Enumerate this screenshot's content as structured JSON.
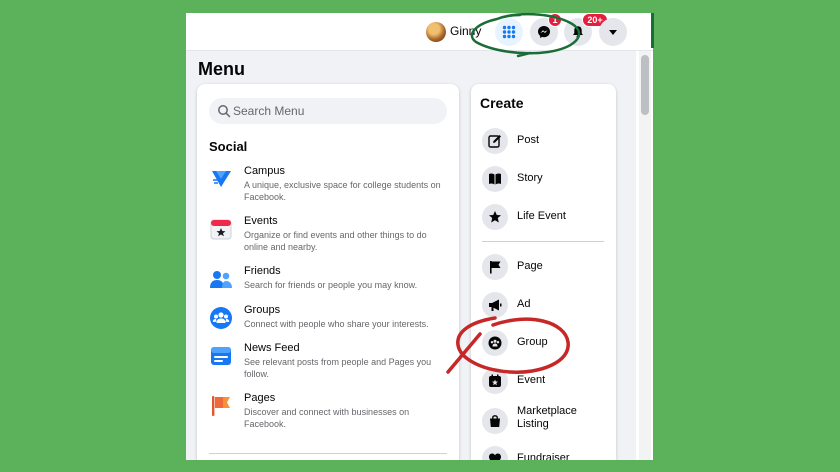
{
  "colors": {
    "background": "#5cb25a",
    "accent": "#1877f2",
    "badge": "#e41e3f",
    "annotation_green": "#1b6d37",
    "annotation_red": "#c62828"
  },
  "topbar": {
    "username": "Ginny",
    "messenger_badge": "1",
    "notifications_badge": "20+"
  },
  "menu": {
    "title": "Menu",
    "search": {
      "placeholder": "Search Menu"
    },
    "social": {
      "title": "Social",
      "items": [
        {
          "name": "Campus",
          "desc": "A unique, exclusive space for college students on Facebook.",
          "icon": "campus-icon"
        },
        {
          "name": "Events",
          "desc": "Organize or find events and other things to do online and nearby.",
          "icon": "events-icon"
        },
        {
          "name": "Friends",
          "desc": "Search for friends or people you may know.",
          "icon": "friends-icon"
        },
        {
          "name": "Groups",
          "desc": "Connect with people who share your interests.",
          "icon": "groups-icon"
        },
        {
          "name": "News Feed",
          "desc": "See relevant posts from people and Pages you follow.",
          "icon": "news-feed-icon"
        },
        {
          "name": "Pages",
          "desc": "Discover and connect with businesses on Facebook.",
          "icon": "pages-icon"
        }
      ]
    }
  },
  "create": {
    "title": "Create",
    "items": [
      {
        "label": "Post",
        "icon": "edit-icon"
      },
      {
        "label": "Story",
        "icon": "book-icon"
      },
      {
        "label": "Life Event",
        "icon": "star-icon"
      },
      {
        "label": "Page",
        "icon": "flag-icon"
      },
      {
        "label": "Ad",
        "icon": "megaphone-icon"
      },
      {
        "label": "Group",
        "icon": "group-icon"
      },
      {
        "label": "Event",
        "icon": "calendar-icon"
      },
      {
        "label": "Marketplace Listing",
        "icon": "shopping-bag-icon"
      },
      {
        "label": "Fundraiser",
        "icon": "heart-icon"
      }
    ]
  }
}
